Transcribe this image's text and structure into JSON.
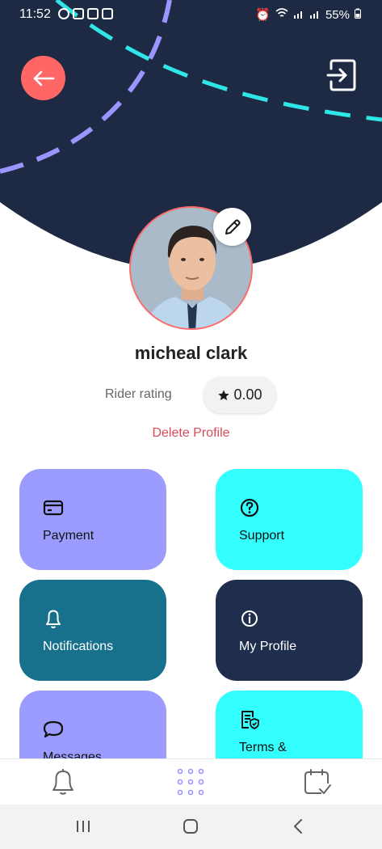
{
  "status_bar": {
    "time": "11:52",
    "battery": "55%"
  },
  "header": {
    "back_icon": "arrow-left-icon",
    "logout_icon": "logout-icon",
    "colors": {
      "navy": "#1e2a44",
      "cyan_dash": "#2ee6e6",
      "purple_dash": "#9a95ff",
      "back_button": "#ff6666"
    }
  },
  "profile": {
    "name": "micheal clark",
    "rating_label": "Rider rating",
    "rating_value": "0.00",
    "delete_label": "Delete Profile",
    "edit_icon": "pencil-icon"
  },
  "tiles": [
    {
      "label": "Payment",
      "icon": "credit-card-icon",
      "color": "#9c9cff"
    },
    {
      "label": "Support",
      "icon": "help-circle-icon",
      "color": "#33ffff"
    },
    {
      "label": "Notifications",
      "icon": "bell-icon",
      "color": "#17718d"
    },
    {
      "label": "My Profile",
      "icon": "info-icon",
      "color": "#1e2e4c"
    },
    {
      "label": "Messages",
      "icon": "chat-bubble-icon",
      "color": "#9c9cff"
    },
    {
      "label": "Terms &",
      "icon": "document-shield-icon",
      "color": "#33ffff"
    }
  ],
  "bottom_nav": {
    "items": [
      "bell-icon",
      "grid-dots-icon",
      "calendar-check-icon"
    ]
  },
  "system_nav": {
    "items": [
      "recents-icon",
      "home-icon",
      "back-icon"
    ]
  }
}
